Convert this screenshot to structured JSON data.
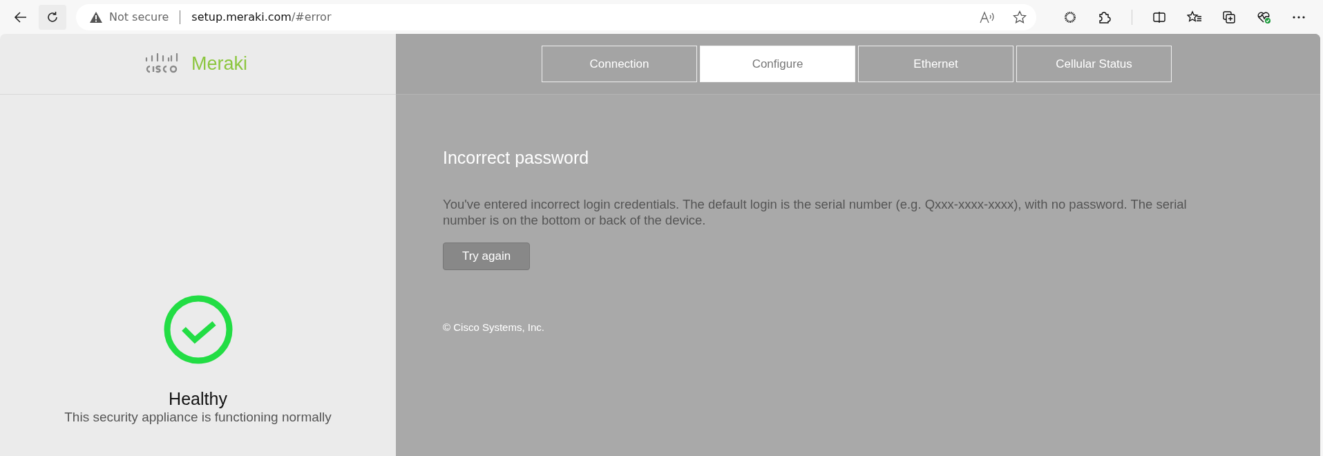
{
  "browser": {
    "security": "Not secure",
    "url_host": "setup.meraki.com",
    "url_path": "/#error"
  },
  "logo": {
    "brand": "Meraki"
  },
  "tabs": [
    {
      "label": "Connection",
      "selected": false
    },
    {
      "label": "Configure",
      "selected": true
    },
    {
      "label": "Ethernet",
      "selected": false
    },
    {
      "label": "Cellular Status",
      "selected": false
    }
  ],
  "status": {
    "kind": "healthy",
    "title": "Healthy",
    "description": "This security appliance is functioning normally"
  },
  "error": {
    "title": "Incorrect password",
    "message": "You've entered incorrect login credentials. The default login is the serial number (e.g. Qxxx-xxxx-xxxx), with no password. The serial number is on the bottom or back of the device.",
    "button": "Try again"
  },
  "footer": "© Cisco Systems, Inc."
}
